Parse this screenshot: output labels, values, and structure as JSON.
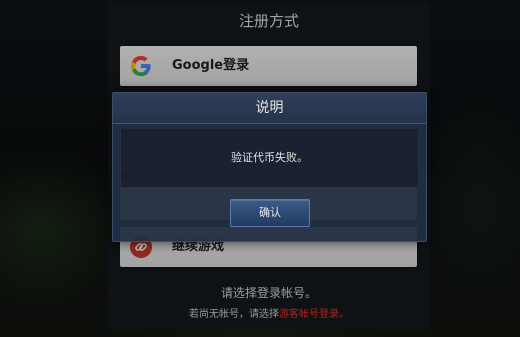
{
  "register_panel": {
    "title": "注册方式",
    "google_login_label": "Google登录",
    "guest_label": "继续游戏",
    "hint_main": "请选择登录帐号。",
    "hint_sub_prefix": "若尚无帐号，请选择",
    "hint_sub_link": "游客帐号登录。"
  },
  "dialog": {
    "title": "说明",
    "message": "验证代币失败。",
    "confirm_label": "确认"
  },
  "colors": {
    "google_blue": "#4285F4",
    "google_red": "#EA4335",
    "google_yellow": "#FBBC05",
    "google_green": "#34A853",
    "guest_icon_red": "#c23a2e",
    "link_red": "#e0322d"
  },
  "icons": {
    "google": "google-icon",
    "guest": "link-icon"
  }
}
